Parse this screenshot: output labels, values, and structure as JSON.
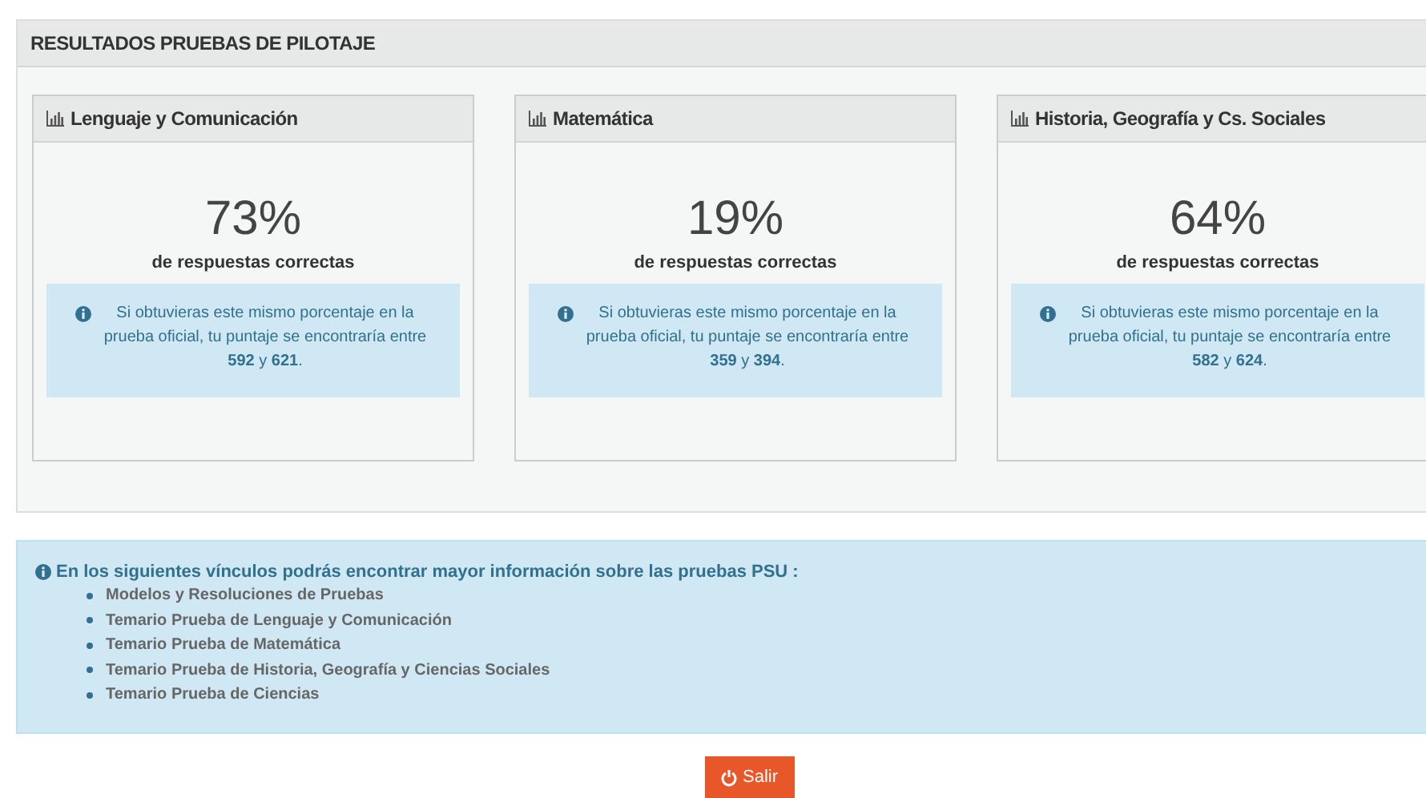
{
  "panel": {
    "title": "RESULTADOS PRUEBAS DE PILOTAJE"
  },
  "results": [
    {
      "subject": "Lenguaje y Comunicación",
      "percent": "73%",
      "caption": "de respuestas correctas",
      "note": "Si obtuvieras este mismo porcentaje en la prueba oficial, tu puntaje se encontraría entre **592** y **621**."
    },
    {
      "subject": "Matemática",
      "percent": "19%",
      "caption": "de respuestas correctas",
      "note": "Si obtuvieras este mismo porcentaje en la prueba oficial, tu puntaje se encontraría entre **359** y **394**."
    },
    {
      "subject": "Historia, Geografía y Cs. Sociales",
      "percent": "64%",
      "caption": "de respuestas correctas",
      "note": "Si obtuvieras este mismo porcentaje en la prueba oficial, tu puntaje se encontraría entre **582** y **624**."
    }
  ],
  "links_info": {
    "heading": "En los siguientes vínculos podrás encontrar mayor información sobre las pruebas PSU :",
    "links": [
      "Modelos y Resoluciones de Pruebas",
      "Temario Prueba de Lenguaje y Comunicación",
      "Temario Prueba de Matemática",
      "Temario Prueba de Historia, Geografía y Ciencias Sociales",
      "Temario Prueba de Ciencias"
    ]
  },
  "exit_button": {
    "label": "Salir"
  }
}
